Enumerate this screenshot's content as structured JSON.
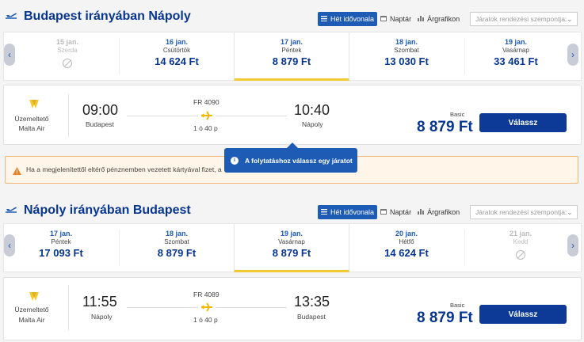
{
  "outbound": {
    "title": "Budapest irányában Nápoly",
    "tabs": [
      {
        "label": "Hét idővonala",
        "icon": "list-icon",
        "active": true
      },
      {
        "label": "Naptár",
        "icon": "calendar-icon",
        "active": false
      },
      {
        "label": "Árgrafikon",
        "icon": "bar-chart-icon",
        "active": false
      }
    ],
    "sort_placeholder": "Járatok rendezési szempontja:",
    "days": [
      {
        "date": "15 jan.",
        "weekday": "Szerda",
        "price": "",
        "available": false
      },
      {
        "date": "16 jan.",
        "weekday": "Csütörtök",
        "price": "14 624 Ft",
        "available": true
      },
      {
        "date": "17 jan.",
        "weekday": "Péntek",
        "price": "8 879 Ft",
        "available": true,
        "selected": true
      },
      {
        "date": "18 jan.",
        "weekday": "Szombat",
        "price": "13 030 Ft",
        "available": true
      },
      {
        "date": "19 jan.",
        "weekday": "Vasárnap",
        "price": "33 461 Ft",
        "available": true
      }
    ],
    "flight": {
      "operator_label": "Üzemeltető",
      "operator": "Malta Air",
      "dep_time": "09:00",
      "dep_city": "Budapest",
      "flight_no": "FR 4090",
      "duration": "1 ó 40 p",
      "arr_time": "10:40",
      "arr_city": "Nápoly",
      "fare_type": "Basic",
      "price": "8 879 Ft",
      "select_label": "Válassz"
    }
  },
  "warning_text": "Ha a megjelenítettől eltérő pénznemben vezetett kártyával fizet, a",
  "tooltip_text": "A folytatáshoz válassz egy járatot",
  "inbound": {
    "title": "Nápoly irányában Budapest",
    "tabs": [
      {
        "label": "Hét idővonala",
        "icon": "list-icon",
        "active": true
      },
      {
        "label": "Naptár",
        "icon": "calendar-icon",
        "active": false
      },
      {
        "label": "Árgrafikon",
        "icon": "bar-chart-icon",
        "active": false
      }
    ],
    "sort_placeholder": "Járatok rendezési szempontja:",
    "days": [
      {
        "date": "17 jan.",
        "weekday": "Péntek",
        "price": "17 093 Ft",
        "available": true
      },
      {
        "date": "18 jan.",
        "weekday": "Szombat",
        "price": "8 879 Ft",
        "available": true
      },
      {
        "date": "19 jan.",
        "weekday": "Vasárnap",
        "price": "8 879 Ft",
        "available": true,
        "selected": true
      },
      {
        "date": "20 jan.",
        "weekday": "Hétfő",
        "price": "14 624 Ft",
        "available": true
      },
      {
        "date": "21 jan.",
        "weekday": "Kedd",
        "price": "",
        "available": false
      }
    ],
    "flight": {
      "operator_label": "Üzemeltető",
      "operator": "Malta Air",
      "dep_time": "11:55",
      "dep_city": "Nápoly",
      "flight_no": "FR 4089",
      "duration": "1 ó 40 p",
      "arr_time": "13:35",
      "arr_city": "Budapest",
      "fare_type": "Basic",
      "price": "8 879 Ft",
      "select_label": "Válassz"
    }
  },
  "colors": {
    "brand": "#073590",
    "accent": "#1d5bb5",
    "highlight": "#f1c933",
    "button": "#0c3a96"
  }
}
